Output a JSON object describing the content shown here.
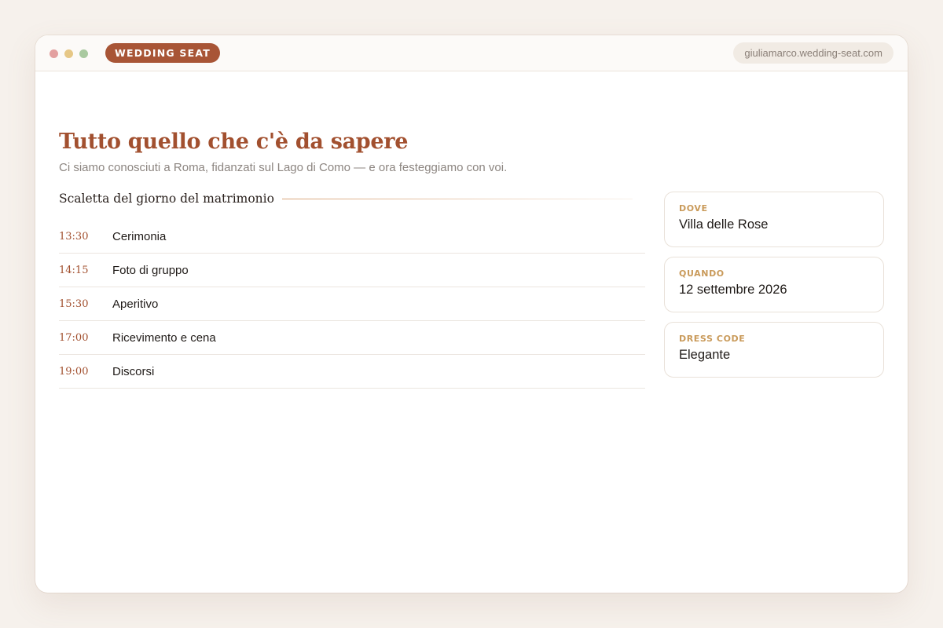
{
  "window": {
    "brand": "WEDDING SEAT",
    "url": "giuliamarco.wedding-seat.com"
  },
  "page": {
    "title": "Tutto quello che c'è da sapere",
    "subtitle": "Ci siamo conosciuti a Roma, fidanzati sul Lago di Como — e ora festeggiamo con voi."
  },
  "schedule": {
    "title": "Scaletta del giorno del matrimonio",
    "items": [
      {
        "time": "13:30",
        "event": "Cerimonia"
      },
      {
        "time": "14:15",
        "event": "Foto di gruppo"
      },
      {
        "time": "15:30",
        "event": "Aperitivo"
      },
      {
        "time": "17:00",
        "event": "Ricevimento e cena"
      },
      {
        "time": "19:00",
        "event": "Discorsi"
      }
    ]
  },
  "details": [
    {
      "label": "DOVE",
      "value": "Villa delle Rose"
    },
    {
      "label": "QUANDO",
      "value": "12 settembre 2026"
    },
    {
      "label": "DRESS CODE",
      "value": "Elegante"
    }
  ],
  "colors": {
    "accent": "#a85536",
    "title": "#a2502f",
    "label_gold": "#c99a5a",
    "background": "#f6f1ec"
  }
}
